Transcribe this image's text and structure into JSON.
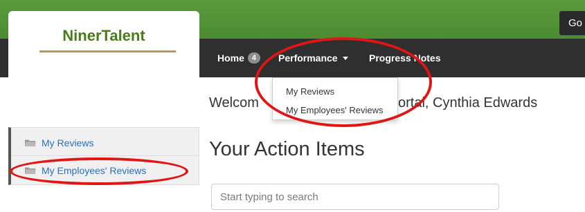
{
  "header": {
    "go_label": "Go"
  },
  "logo": {
    "name": "NinerTalent"
  },
  "nav": {
    "home_label": "Home",
    "home_badge": "4",
    "performance_label": "Performance",
    "progress_label": "Progress Notes"
  },
  "dropdown": {
    "items": [
      "My Reviews",
      "My Employees' Reviews"
    ]
  },
  "main": {
    "welcome_left": "Welcom",
    "welcome_right": "ortal, Cynthia Edwards",
    "action_title": "Your Action Items",
    "search_placeholder": "Start typing to search"
  },
  "sidebar": {
    "items": [
      {
        "label": "My Reviews",
        "icon": "folder-icon"
      },
      {
        "label": "My Employees' Reviews",
        "icon": "folder-icon"
      }
    ]
  },
  "colors": {
    "green": "#4b8c34",
    "dark": "#2f2f2f",
    "link": "#2a6fbd",
    "highlight": "#e01616"
  }
}
